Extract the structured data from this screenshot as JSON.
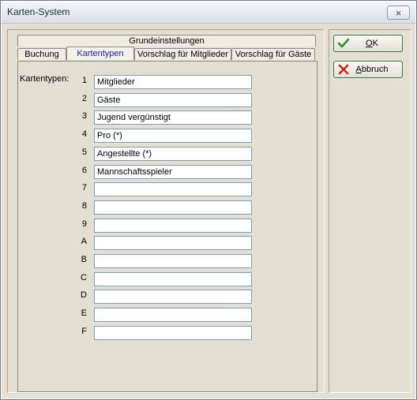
{
  "window": {
    "title": "Karten-System",
    "close_symbol": "×"
  },
  "tabs": {
    "top_row": [
      "Grundeinstellungen"
    ],
    "bottom_row": [
      "Buchung",
      "Kartentypen",
      "Vorschlag für Mitglieder",
      "Vorschlag für Gäste"
    ],
    "active": "Kartentypen"
  },
  "form": {
    "label": "Kartentypen:",
    "rows": [
      {
        "num": "1",
        "value": "Mitglieder"
      },
      {
        "num": "2",
        "value": "Gäste"
      },
      {
        "num": "3",
        "value": "Jugend vergünstigt"
      },
      {
        "num": "4",
        "value": "Pro (*)"
      },
      {
        "num": "5",
        "value": "Angestellte (*)"
      },
      {
        "num": "6",
        "value": "Mannschaftsspieler"
      },
      {
        "num": "7",
        "value": ""
      },
      {
        "num": "8",
        "value": ""
      },
      {
        "num": "9",
        "value": ""
      },
      {
        "num": "A",
        "value": ""
      },
      {
        "num": "B",
        "value": ""
      },
      {
        "num": "C",
        "value": ""
      },
      {
        "num": "D",
        "value": ""
      },
      {
        "num": "E",
        "value": ""
      },
      {
        "num": "F",
        "value": ""
      }
    ]
  },
  "buttons": {
    "ok_mnemonic": "O",
    "ok_rest": "K",
    "cancel_mnemonic": "A",
    "cancel_rest": "bbruch"
  },
  "icons": {
    "ok": "checkmark-icon",
    "cancel": "red-x-icon"
  },
  "colors": {
    "active_tab_text": "#1818b0",
    "ok_check": "#2f8a2f",
    "cancel_x": "#d02020"
  }
}
